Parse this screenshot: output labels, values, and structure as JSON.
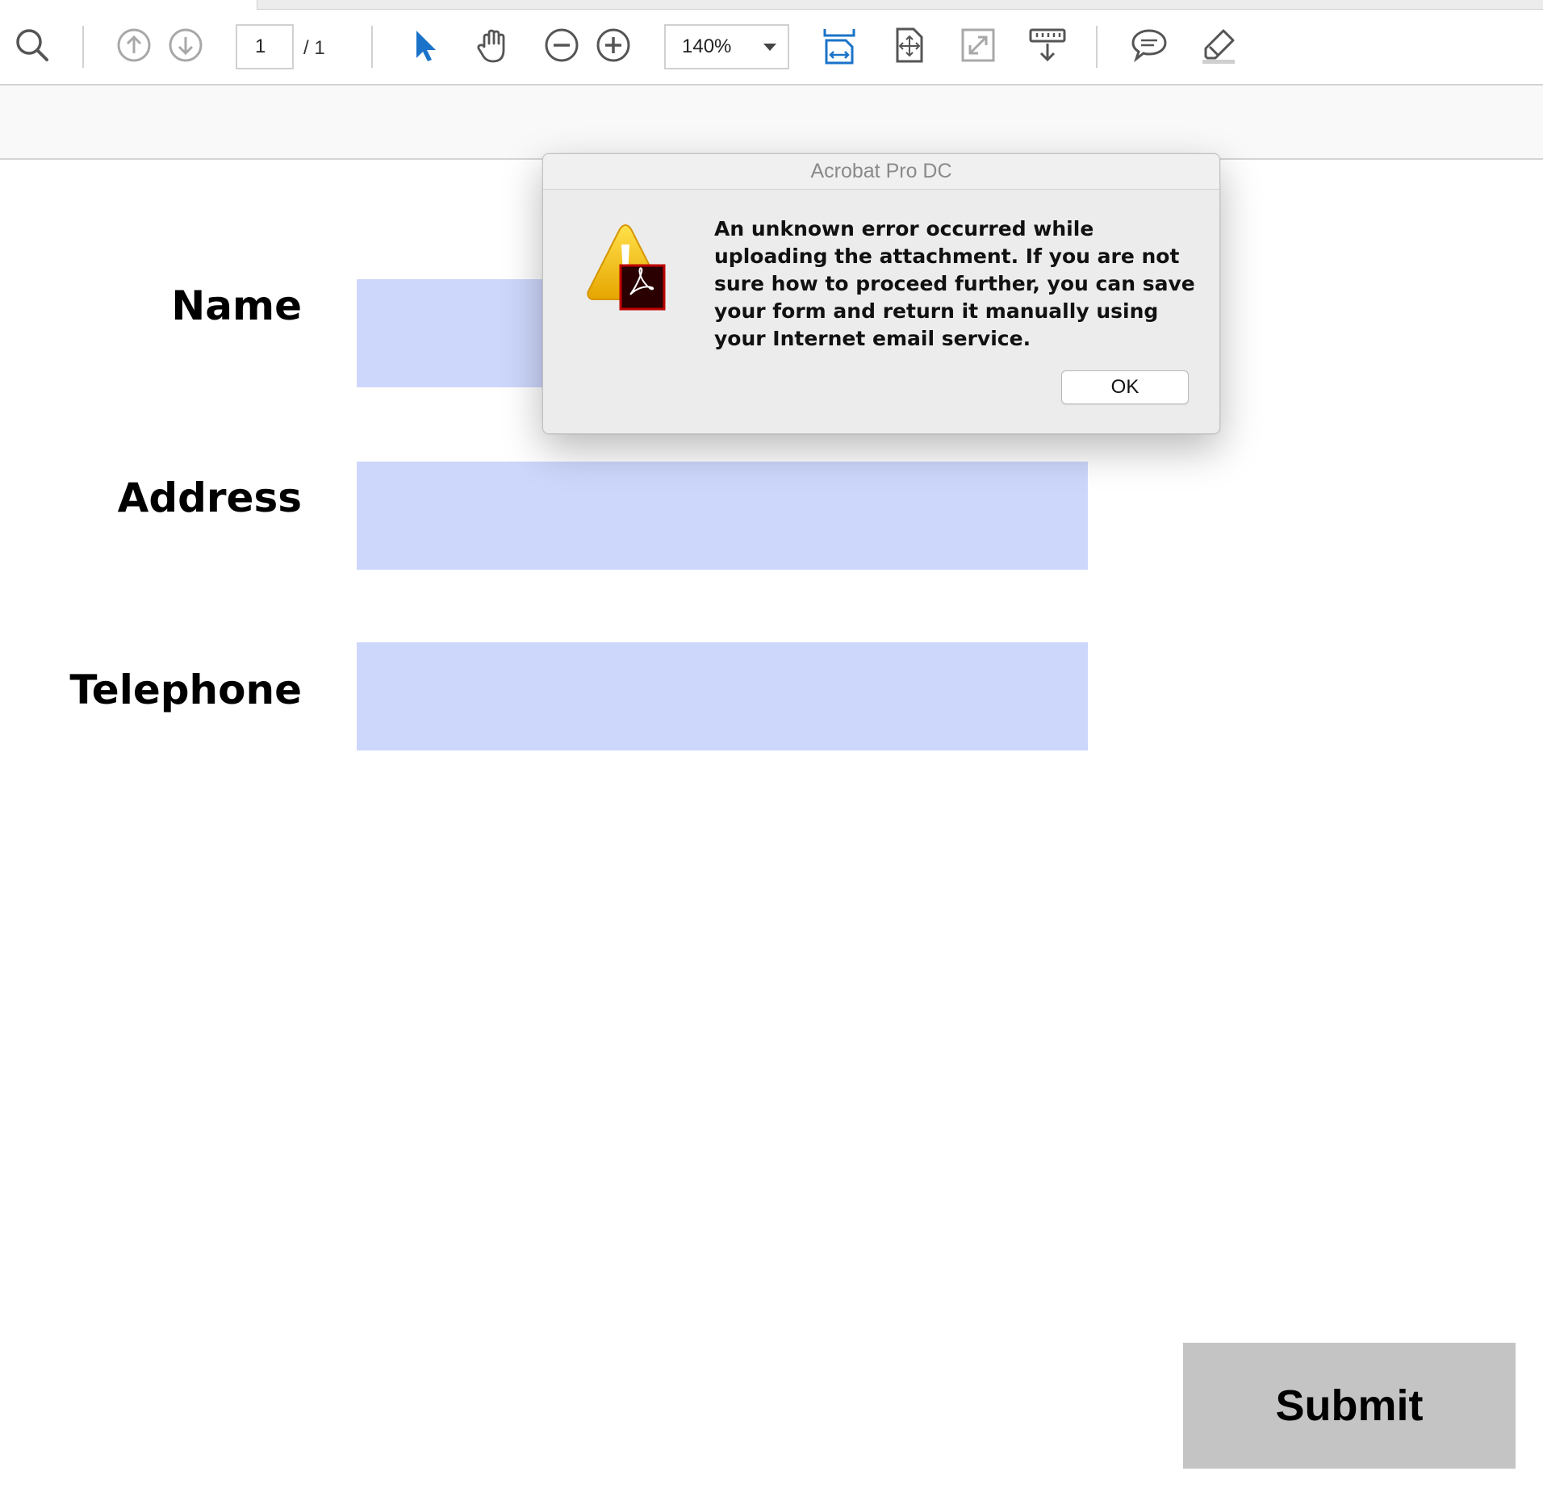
{
  "toolbar": {
    "current_page": "1",
    "total_pages": "/ 1",
    "zoom": "140%",
    "icons": [
      "search-icon",
      "previous-page-icon",
      "next-page-icon",
      "select-cursor-icon",
      "hand-tool-icon",
      "zoom-out-icon",
      "zoom-in-icon",
      "fit-width-icon",
      "fit-page-icon",
      "full-screen-icon",
      "scrolling-mode-icon",
      "comment-icon",
      "highlight-pen-icon"
    ],
    "colors": {
      "accent": "#1a73c9",
      "icon": "#555555",
      "icon_disabled": "#a8a8a8"
    }
  },
  "form": {
    "labels": {
      "name": "Name",
      "address": "Address",
      "telephone": "Telephone"
    },
    "field_color": "#cdd7fb",
    "submit_label": "Submit"
  },
  "dialog": {
    "title": "Acrobat Pro DC",
    "message": "An unknown error occurred while uploading the attachment. If you are not sure how to proceed further, you can save your form and return it manually using your Internet email service.",
    "ok_label": "OK",
    "icon": "warning-acrobat-icon"
  }
}
